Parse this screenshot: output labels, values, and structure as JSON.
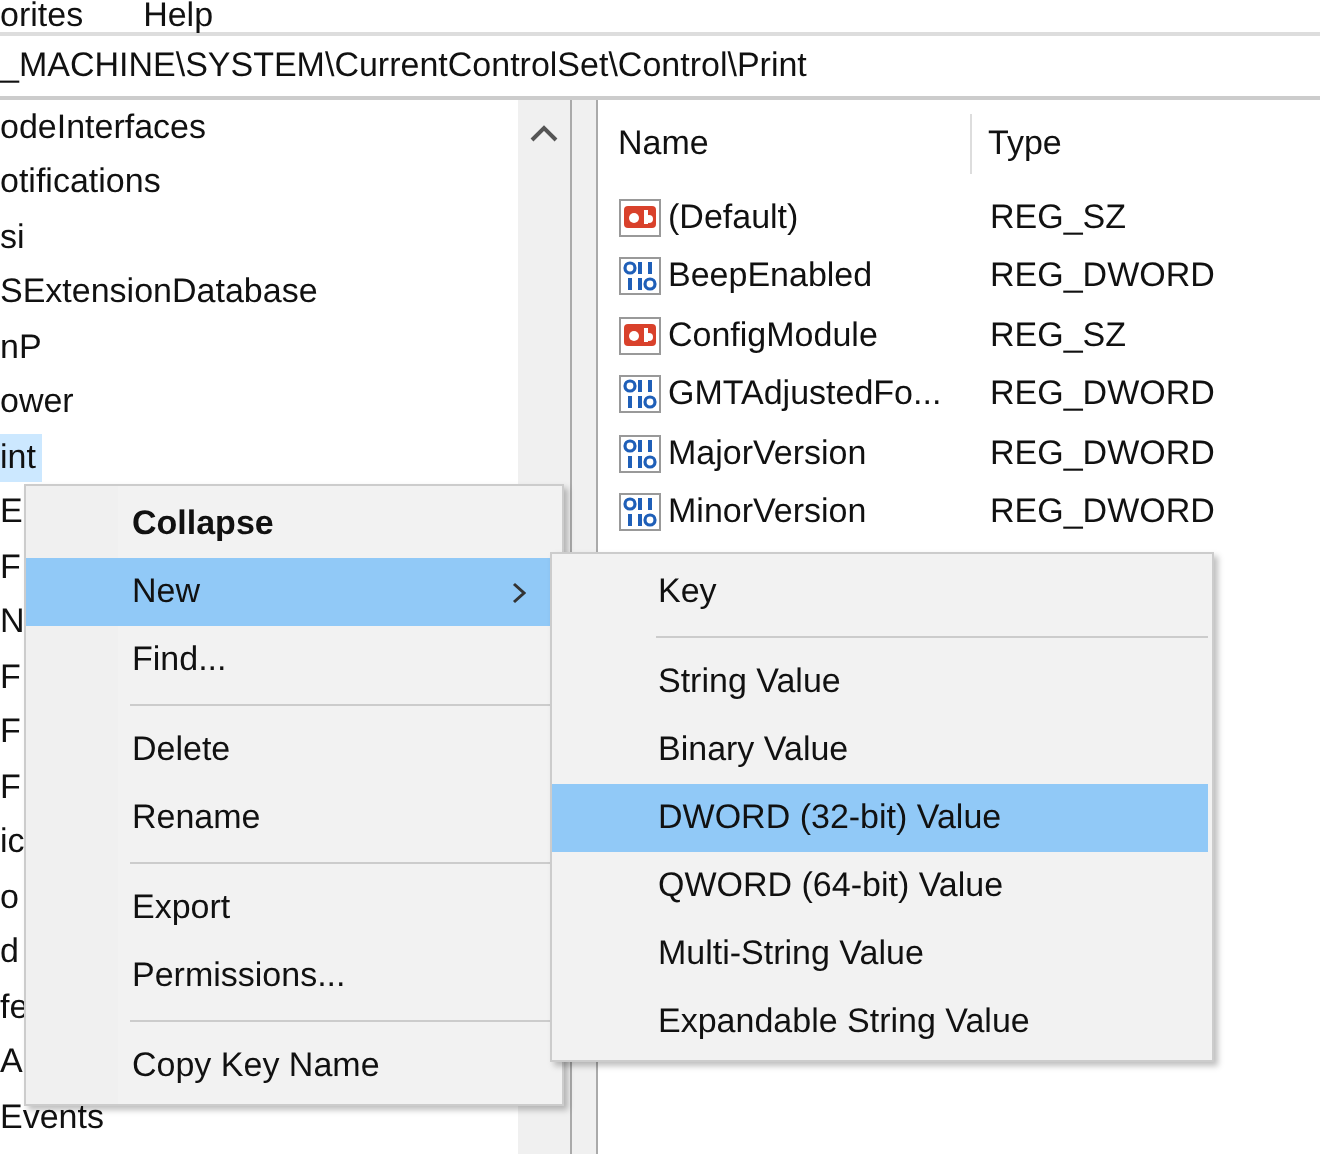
{
  "menu_bar": [
    "orites",
    "Help"
  ],
  "address_bar": "_MACHINE\\SYSTEM\\CurrentControlSet\\Control\\Print",
  "tree": {
    "items": [
      {
        "label": "odeInterfaces",
        "selected": false
      },
      {
        "label": "otifications",
        "selected": false
      },
      {
        "label": "si",
        "selected": false
      },
      {
        "label": "SExtensionDatabase",
        "selected": false
      },
      {
        "label": "nP",
        "selected": false
      },
      {
        "label": "ower",
        "selected": false
      },
      {
        "label": "int",
        "selected": true
      },
      {
        "label": "E",
        "selected": false
      },
      {
        "label": "F",
        "selected": false
      },
      {
        "label": "N",
        "selected": false
      },
      {
        "label": "F",
        "selected": false
      },
      {
        "label": "F",
        "selected": false
      },
      {
        "label": "F",
        "selected": false
      },
      {
        "label": "ic",
        "selected": false
      },
      {
        "label": "o",
        "selected": false
      },
      {
        "label": "d",
        "selected": false
      },
      {
        "label": "fe",
        "selected": false
      },
      {
        "label": "A",
        "selected": false
      },
      {
        "label": "Events",
        "selected": false
      }
    ]
  },
  "values": {
    "columns": [
      "Name",
      "Type"
    ],
    "rows": [
      {
        "kind": "string",
        "name": "(Default)",
        "type": "REG_SZ"
      },
      {
        "kind": "binary",
        "name": "BeepEnabled",
        "type": "REG_DWORD"
      },
      {
        "kind": "string",
        "name": "ConfigModule",
        "type": "REG_SZ"
      },
      {
        "kind": "binary",
        "name": "GMTAdjustedFo...",
        "type": "REG_DWORD"
      },
      {
        "kind": "binary",
        "name": "MajorVersion",
        "type": "REG_DWORD"
      },
      {
        "kind": "binary",
        "name": "MinorVersion",
        "type": "REG_DWORD"
      }
    ]
  },
  "context_menu": {
    "groups": [
      [
        {
          "label": "Collapse",
          "default": true,
          "selected": false,
          "submenu": false
        },
        {
          "label": "New",
          "default": false,
          "selected": true,
          "submenu": true
        },
        {
          "label": "Find...",
          "default": false,
          "selected": false,
          "submenu": false
        }
      ],
      [
        {
          "label": "Delete",
          "default": false,
          "selected": false,
          "submenu": false
        },
        {
          "label": "Rename",
          "default": false,
          "selected": false,
          "submenu": false
        }
      ],
      [
        {
          "label": "Export",
          "default": false,
          "selected": false,
          "submenu": false
        },
        {
          "label": "Permissions...",
          "default": false,
          "selected": false,
          "submenu": false
        }
      ],
      [
        {
          "label": "Copy Key Name",
          "default": false,
          "selected": false,
          "submenu": false
        }
      ]
    ]
  },
  "submenu": {
    "groups": [
      [
        {
          "label": "Key",
          "selected": false
        }
      ],
      [
        {
          "label": "String Value",
          "selected": false
        },
        {
          "label": "Binary Value",
          "selected": false
        },
        {
          "label": "DWORD (32-bit) Value",
          "selected": true
        },
        {
          "label": "QWORD (64-bit) Value",
          "selected": false
        },
        {
          "label": "Multi-String Value",
          "selected": false
        },
        {
          "label": "Expandable String Value",
          "selected": false
        }
      ]
    ]
  }
}
